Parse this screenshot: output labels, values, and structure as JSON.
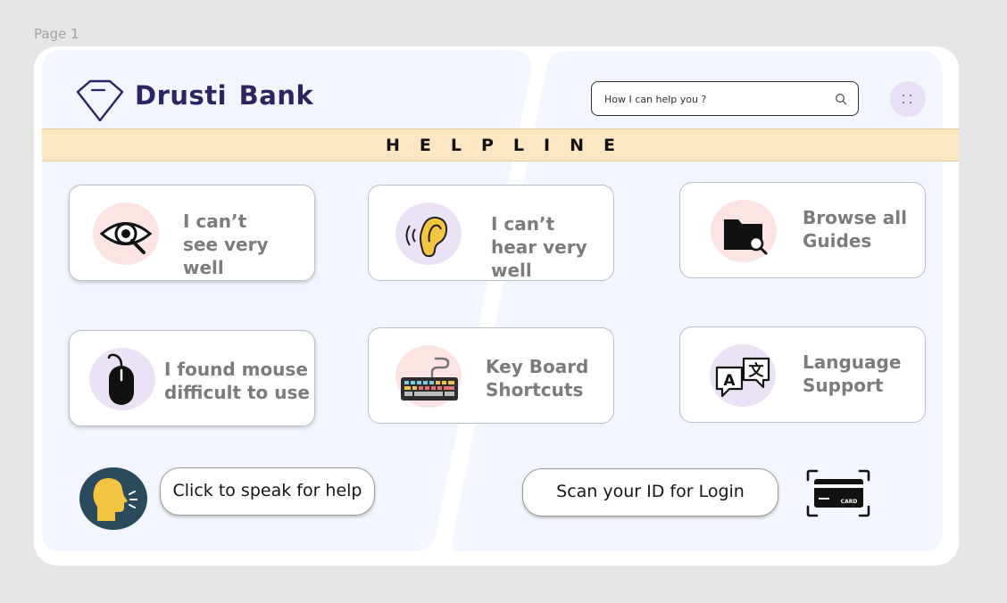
{
  "page": {
    "label": "Page 1"
  },
  "header": {
    "brand": "Drusti  Bank",
    "search": {
      "placeholder": "How I can help you ?"
    }
  },
  "banner": {
    "title": "HELPLINE"
  },
  "options": [
    {
      "label": "I can’t see very well",
      "icon": "eye-icon"
    },
    {
      "label": "I can’t hear very well",
      "icon": "ear-icon"
    },
    {
      "label": "Browse all Guides",
      "icon": "folder-search-icon"
    },
    {
      "label": "I found mouse difficult to use",
      "icon": "mouse-icon"
    },
    {
      "label": "Key Board Shortcuts",
      "icon": "keyboard-icon"
    },
    {
      "label": "Language Support",
      "icon": "translate-icon"
    }
  ],
  "actions": {
    "speak": {
      "label": "Click to speak for help",
      "icon": "speaking-head-icon"
    },
    "scan": {
      "label": "Scan your ID for Login",
      "icon": "scan-card-icon",
      "card_text": "CARD"
    }
  },
  "colors": {
    "brand": "#2d2461",
    "banner": "#fde6c2",
    "panel": "#f3f6fe",
    "circle_pink": "#fde4e4",
    "circle_lavender": "#ebe3f5",
    "speak_bg": "#2c4a5e"
  }
}
